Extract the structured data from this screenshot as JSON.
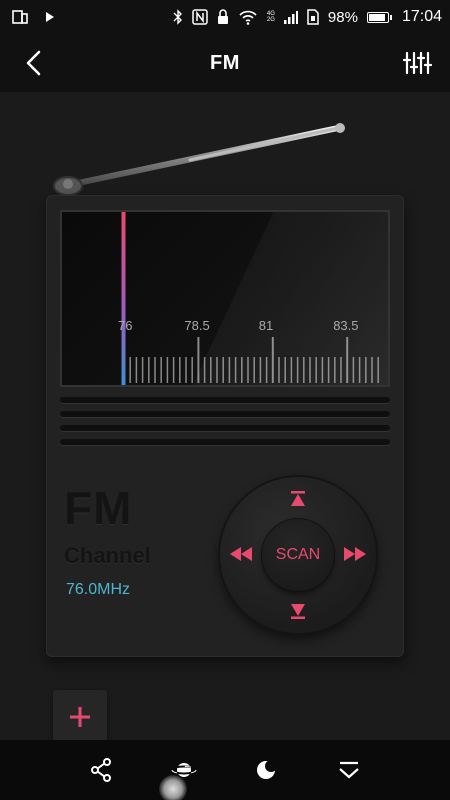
{
  "status_bar": {
    "battery_percent": "98%",
    "time": "17:04",
    "network_top": "4G",
    "network_bottom": "2G",
    "icons": [
      "multiwindow-icon",
      "play-icon",
      "bluetooth-icon",
      "nfc-icon",
      "lock-icon",
      "wifi-icon",
      "signal-icon",
      "sim-icon",
      "battery-icon"
    ]
  },
  "header": {
    "title": "FM",
    "back_icon": "back-arrow-icon",
    "settings_icon": "equalizer-icon"
  },
  "dial": {
    "tick_labels": [
      "76",
      "78.5",
      "81",
      "83.5"
    ],
    "current_frequency_mhz": 76.0,
    "needle_color": "#e84a6f"
  },
  "info": {
    "band": "FM",
    "channel_label": "Channel",
    "frequency": "76.0MHz"
  },
  "control_pad": {
    "center_label": "SCAN",
    "up_icon": "step-up-icon",
    "down_icon": "step-down-icon",
    "left_icon": "seek-back-icon",
    "right_icon": "seek-forward-icon",
    "accent": "#e84a6f"
  },
  "add_button": {
    "icon": "plus-icon"
  },
  "bottom_nav": {
    "items": [
      "share-icon",
      "planet-icon",
      "moon-icon",
      "collapse-icon"
    ]
  }
}
